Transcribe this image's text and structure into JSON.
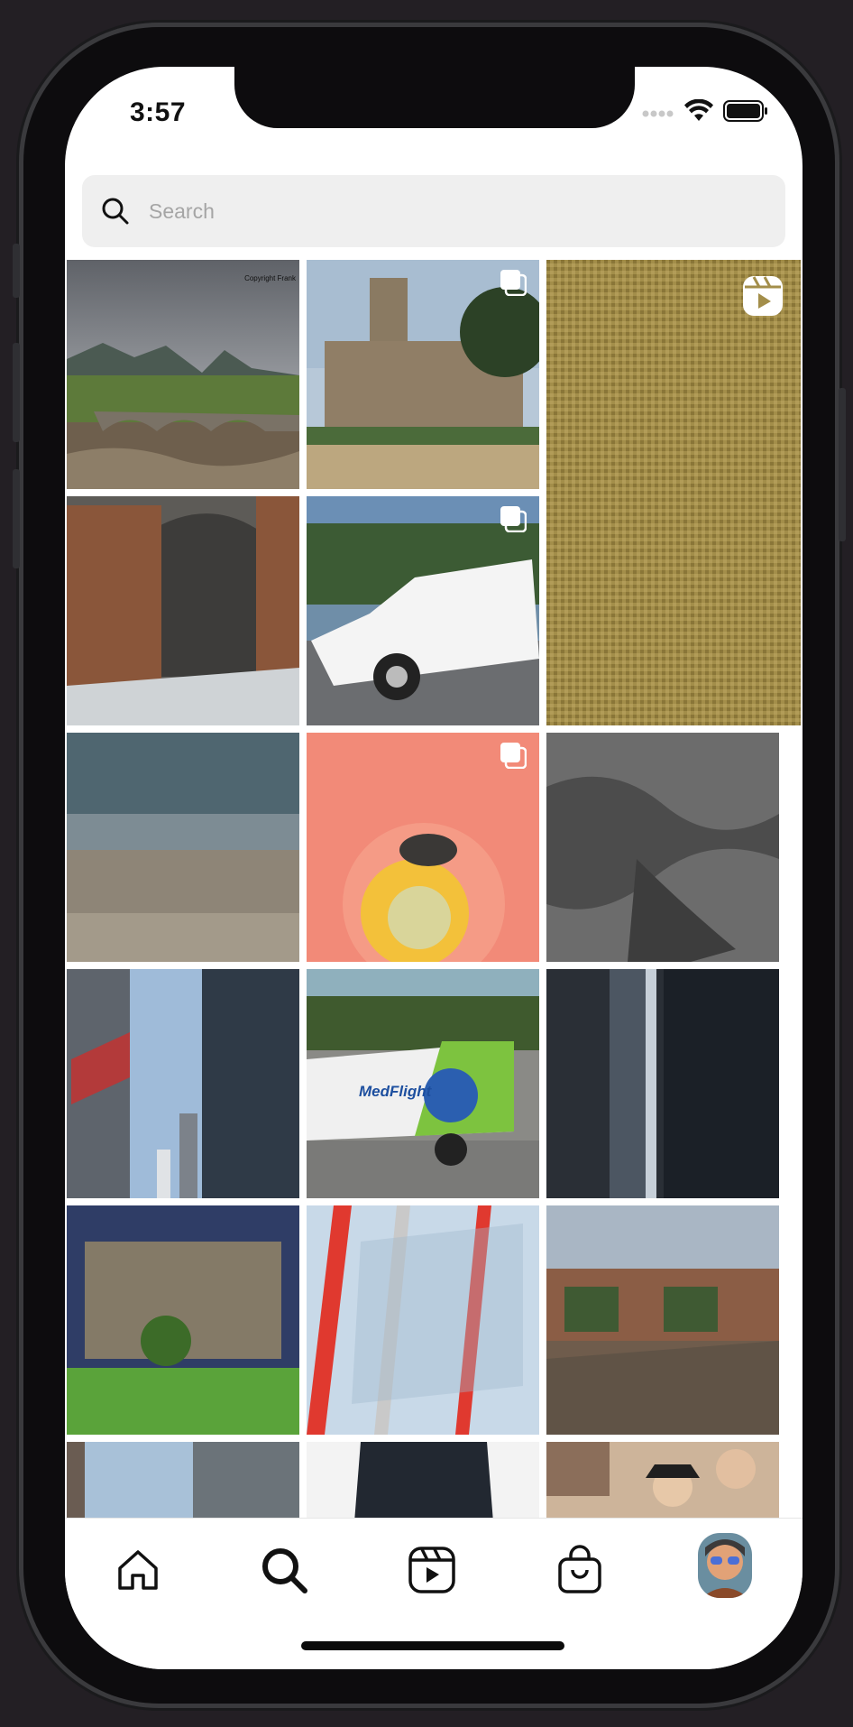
{
  "status_bar": {
    "time": "3:57"
  },
  "search": {
    "placeholder": "Search",
    "value": ""
  },
  "grid_photos": [
    {
      "subject": "mountain-stone-bridge",
      "caption": "Copyright Frank"
    },
    {
      "subject": "cathedral-garden",
      "badge": "multi-icon"
    },
    {
      "subject": "burlap-texture",
      "badge": "reels-icon"
    },
    {
      "subject": "tunnel-rusty-doors"
    },
    {
      "subject": "white-limousine",
      "badge": "multi-icon"
    },
    {
      "subject": "beach-waves"
    },
    {
      "subject": "fly-on-pink-flower",
      "badge": "multi-icon"
    },
    {
      "subject": "grey-water-ripples"
    },
    {
      "subject": "skyscrapers-flag"
    },
    {
      "subject": "medflight-ambulance",
      "text": "MedFlight"
    },
    {
      "subject": "dark-city-towers"
    },
    {
      "subject": "glass-office-building-lawn"
    },
    {
      "subject": "red-stripe-facade"
    },
    {
      "subject": "abandoned-depot"
    },
    {
      "subject": "building-looking-up"
    },
    {
      "subject": "person-dark-suit"
    },
    {
      "subject": "vintage-men-illustration"
    }
  ],
  "tab_bar": [
    "home-icon",
    "search-icon",
    "reels-icon",
    "shop-icon",
    "profile-avatar"
  ],
  "colors": {
    "background": "#231f24",
    "screen": "#ffffff",
    "search_bg": "#efefef"
  }
}
